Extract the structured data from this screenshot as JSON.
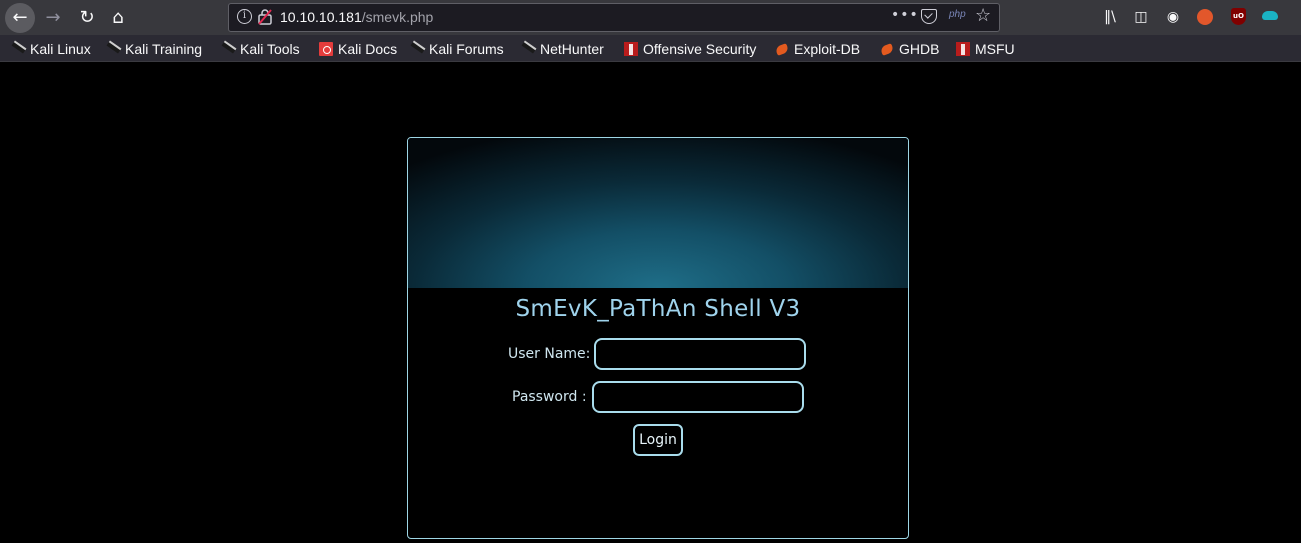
{
  "browser": {
    "url_host": "10.10.10.181",
    "url_path": "/smevk.php",
    "url_badge": "php",
    "bookmarks": [
      {
        "label": "Kali Linux",
        "icon": "kali-dragon-icon"
      },
      {
        "label": "Kali Training",
        "icon": "kali-dragon-icon"
      },
      {
        "label": "Kali Tools",
        "icon": "kali-dragon-icon"
      },
      {
        "label": "Kali Docs",
        "icon": "kali-docs-icon"
      },
      {
        "label": "Kali Forums",
        "icon": "kali-dragon-icon"
      },
      {
        "label": "NetHunter",
        "icon": "kali-dragon-icon"
      },
      {
        "label": "Offensive Security",
        "icon": "offsec-icon"
      },
      {
        "label": "Exploit-DB",
        "icon": "exploit-db-icon"
      },
      {
        "label": "GHDB",
        "icon": "exploit-db-icon"
      },
      {
        "label": "MSFU",
        "icon": "offsec-icon"
      }
    ]
  },
  "page": {
    "title": "SmEvK_PaThAn Shell V3",
    "username_label": "User Name:",
    "username_value": "",
    "password_label": "Password :",
    "password_value": "",
    "login_label": "Login"
  },
  "colors": {
    "accent": "#9fd3ec",
    "field_border": "#a9dcec",
    "background": "#000000"
  }
}
